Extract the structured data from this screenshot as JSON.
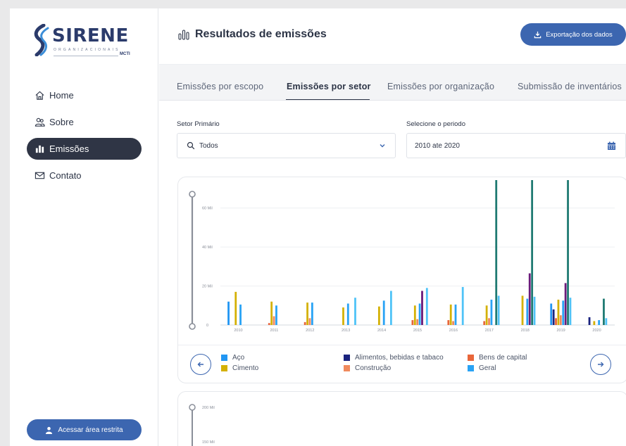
{
  "sidebar": {
    "logo": {
      "name": "SIRENE",
      "subtitle": "ORGANIZACIONAIS",
      "mark": "MCTI"
    },
    "nav": [
      {
        "label": "Home",
        "icon": "home-icon",
        "active": false
      },
      {
        "label": "Sobre",
        "icon": "users-icon",
        "active": false
      },
      {
        "label": "Emissões",
        "icon": "bar-chart-icon",
        "active": true
      },
      {
        "label": "Contato",
        "icon": "mail-icon",
        "active": false
      }
    ],
    "restricted_label": "Acessar área restrita"
  },
  "header": {
    "title": "Resultados de emissões",
    "export_label": "Exportação dos dados"
  },
  "tabs": [
    {
      "label": "Emissões por escopo",
      "active": false
    },
    {
      "label": "Emissões por setor",
      "active": true
    },
    {
      "label": "Emissões por organização",
      "active": false
    },
    {
      "label": "Submissão de inventários",
      "active": false
    }
  ],
  "filters": {
    "sector_label": "Setor Primário",
    "sector_value": "Todos",
    "period_label": "Selecione o periodo",
    "period_value": "2010 ate 2020"
  },
  "colors": {
    "accent": "#3c66b0",
    "sidebar_active": "#2f3545"
  },
  "chart_data": {
    "type": "bar",
    "categories": [
      "2010",
      "2011",
      "2012",
      "2013",
      "2014",
      "2015",
      "2016",
      "2017",
      "2018",
      "2019",
      "2020"
    ],
    "y_ticks": [
      "0",
      "20 Mil",
      "40 Mil",
      "60 Mil"
    ],
    "ylim": [
      0,
      70000
    ],
    "series": [
      {
        "name": "Aço",
        "color": "#2196f3",
        "values": [
          12000,
          0,
          0,
          0,
          0,
          0,
          0,
          0,
          0,
          11000,
          0
        ]
      },
      {
        "name": "Alimentos, bebidas e tabaco",
        "color": "#1a237e",
        "values": [
          0,
          0,
          0,
          0,
          0,
          0,
          0,
          0,
          0,
          8000,
          4000
        ]
      },
      {
        "name": "Bens de capital",
        "color": "#e8663a",
        "values": [
          0,
          1000,
          1500,
          0,
          0,
          2500,
          2500,
          2000,
          0,
          3500,
          0
        ]
      },
      {
        "name": "Cimento",
        "color": "#d4b106",
        "values": [
          17000,
          12000,
          11500,
          9000,
          9500,
          10000,
          10500,
          10000,
          15000,
          13000,
          2000
        ]
      },
      {
        "name": "Construção",
        "color": "#f08a5d",
        "values": [
          0,
          4500,
          3500,
          0,
          0,
          3000,
          2000,
          3500,
          0,
          5000,
          0
        ]
      },
      {
        "name": "Geral",
        "color": "#29a3f5",
        "values": [
          10500,
          10000,
          11500,
          11000,
          12500,
          11000,
          10500,
          13000,
          13500,
          12500,
          2500
        ]
      },
      {
        "name": "",
        "color": "#6a1b7a",
        "values": [
          0,
          0,
          0,
          0,
          0,
          17500,
          0,
          0,
          26500,
          21500,
          0
        ]
      },
      {
        "name": "",
        "color": "#1f7a72",
        "values": [
          0,
          0,
          0,
          0,
          0,
          0,
          0,
          86000,
          82000,
          79000,
          13500
        ]
      },
      {
        "name": "",
        "color": "#4fc3f7",
        "values": [
          0,
          0,
          0,
          14000,
          17500,
          19000,
          19500,
          15000,
          14500,
          14000,
          3500
        ]
      }
    ],
    "legend": [
      {
        "label": "Aço",
        "color": "#2196f3"
      },
      {
        "label": "Alimentos, bebidas e tabaco",
        "color": "#1a237e"
      },
      {
        "label": "Bens de capital",
        "color": "#e8663a"
      },
      {
        "label": "Cimento",
        "color": "#d4b106"
      },
      {
        "label": "Construção",
        "color": "#f08a5d"
      },
      {
        "label": "Geral",
        "color": "#29a3f5"
      }
    ]
  },
  "second_chart": {
    "y_ticks": [
      "200 Mil",
      "150 Mil"
    ]
  }
}
